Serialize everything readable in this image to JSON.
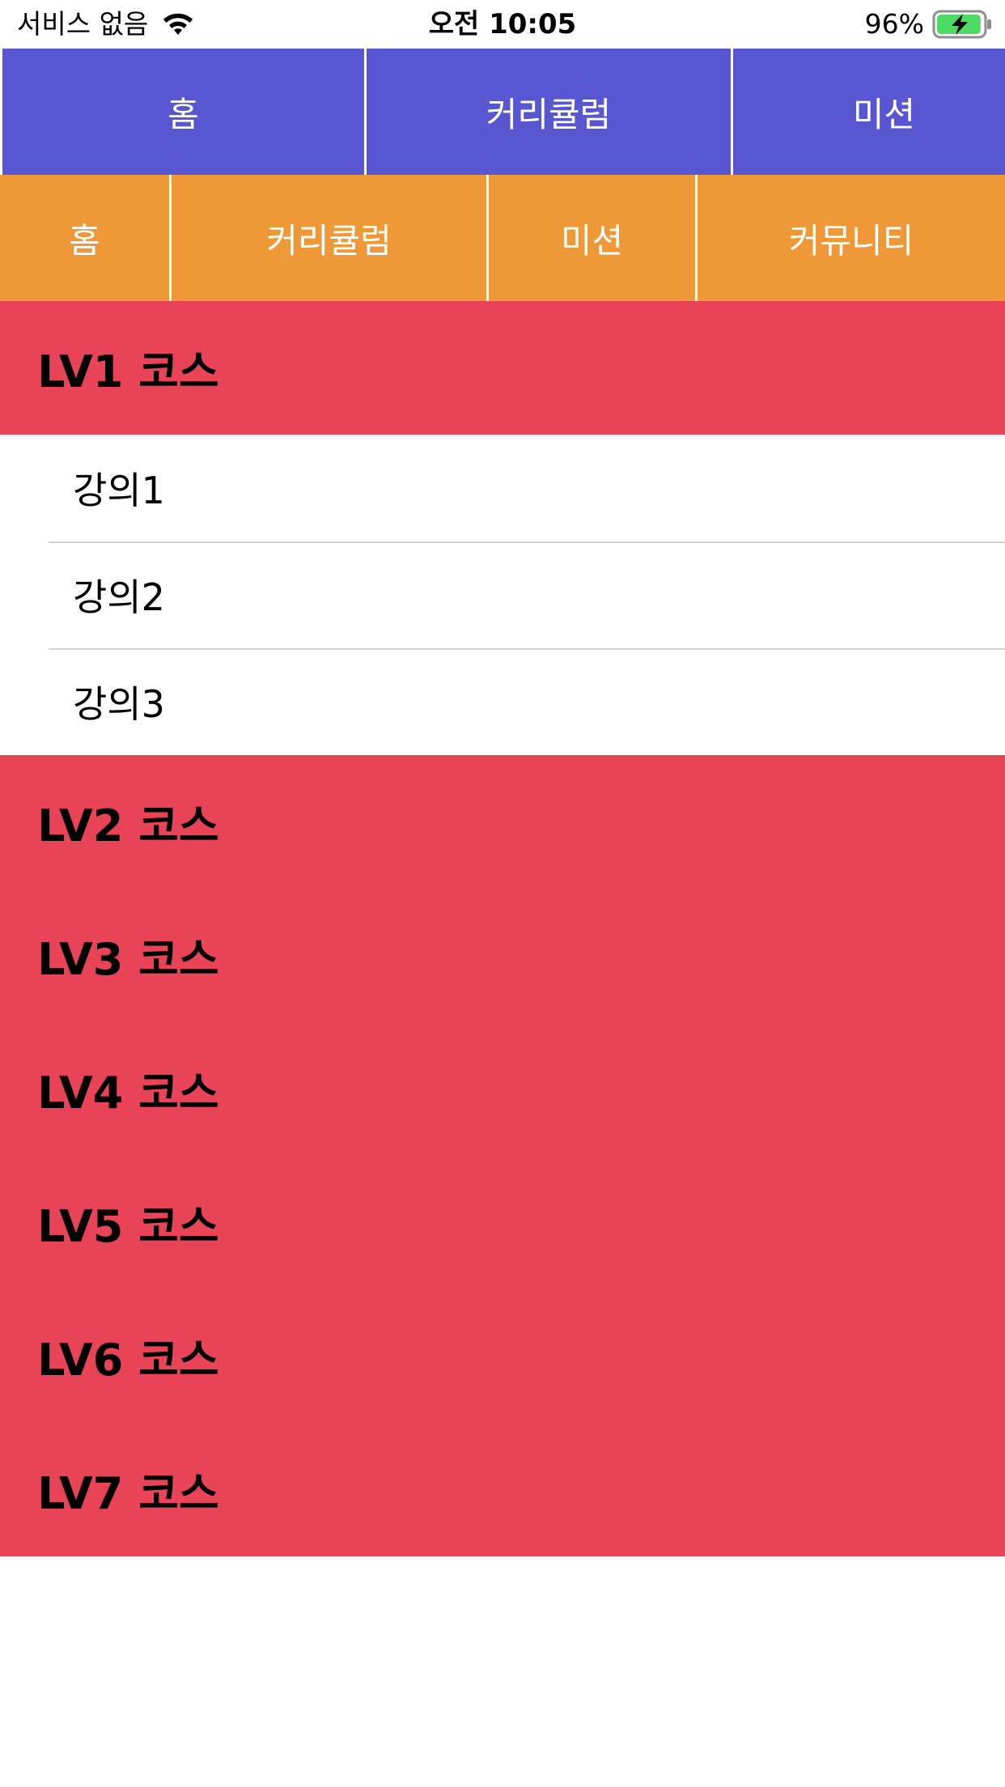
{
  "status_bar": {
    "carrier": "서비스 없음",
    "time": "오전 10:05",
    "battery_percent": "96%",
    "battery_level": 0.96,
    "charging": true
  },
  "colors": {
    "top_tabbar": "#5856d0",
    "bottom_tabbar": "#ef9838",
    "course_header": "#e94358",
    "separator": "#d1d1d6",
    "battery_fill": "#4cd964"
  },
  "top_tabs": [
    {
      "label": "홈"
    },
    {
      "label": "커리큘럼"
    },
    {
      "label": "미션"
    }
  ],
  "bottom_tabs": [
    {
      "label": "홈"
    },
    {
      "label": "커리큘럼"
    },
    {
      "label": "미션"
    },
    {
      "label": "커뮤니티"
    }
  ],
  "courses": [
    {
      "title": "LV1 코스",
      "expanded": true,
      "lectures": [
        "강의1",
        "강의2",
        "강의3"
      ]
    },
    {
      "title": "LV2 코스"
    },
    {
      "title": "LV3 코스"
    },
    {
      "title": "LV4 코스"
    },
    {
      "title": "LV5 코스"
    },
    {
      "title": "LV6 코스"
    },
    {
      "title": "LV7 코스"
    }
  ]
}
